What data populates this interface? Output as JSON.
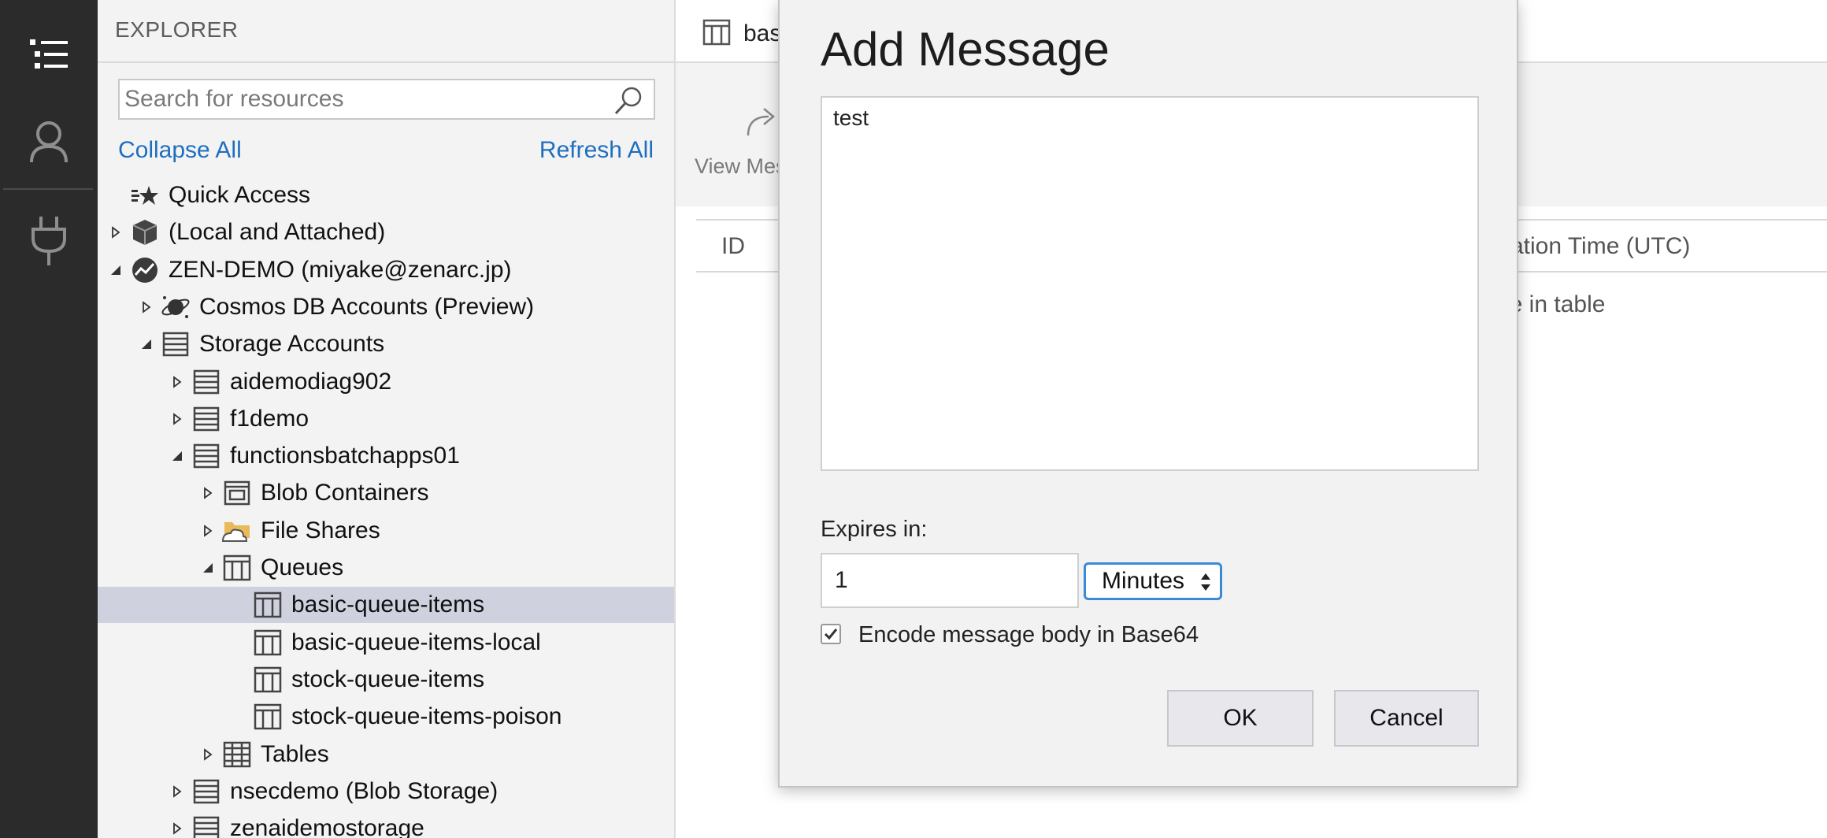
{
  "activity_bar": {
    "icons": [
      "explorer-list-icon",
      "account-icon",
      "plug-icon"
    ]
  },
  "explorer": {
    "title": "EXPLORER",
    "search_placeholder": "Search for resources",
    "collapse_all": "Collapse All",
    "refresh_all": "Refresh All",
    "tree": [
      {
        "label": "Quick Access",
        "level": 0,
        "icon": "quick-access-icon",
        "twisty": "none"
      },
      {
        "label": "(Local and Attached)",
        "level": 0,
        "icon": "cube-icon",
        "twisty": "collapsed"
      },
      {
        "label": "ZEN-DEMO (miyake@zenarc.jp)",
        "level": 0,
        "icon": "subscription-icon",
        "twisty": "expanded"
      },
      {
        "label": "Cosmos DB Accounts (Preview)",
        "level": 1,
        "icon": "cosmos-icon",
        "twisty": "collapsed"
      },
      {
        "label": "Storage Accounts",
        "level": 1,
        "icon": "storage-icon",
        "twisty": "expanded"
      },
      {
        "label": "aidemodiag902",
        "level": 2,
        "icon": "storage-icon",
        "twisty": "collapsed"
      },
      {
        "label": "f1demo",
        "level": 2,
        "icon": "storage-icon",
        "twisty": "collapsed"
      },
      {
        "label": "functionsbatchapps01",
        "level": 2,
        "icon": "storage-icon",
        "twisty": "expanded"
      },
      {
        "label": "Blob Containers",
        "level": 3,
        "icon": "blob-icon",
        "twisty": "collapsed"
      },
      {
        "label": "File Shares",
        "level": 3,
        "icon": "file-share-icon",
        "twisty": "collapsed"
      },
      {
        "label": "Queues",
        "level": 3,
        "icon": "queue-icon",
        "twisty": "expanded"
      },
      {
        "label": "basic-queue-items",
        "level": 4,
        "icon": "queue-icon",
        "twisty": "none",
        "selected": true
      },
      {
        "label": "basic-queue-items-local",
        "level": 4,
        "icon": "queue-icon",
        "twisty": "none"
      },
      {
        "label": "stock-queue-items",
        "level": 4,
        "icon": "queue-icon",
        "twisty": "none"
      },
      {
        "label": "stock-queue-items-poison",
        "level": 4,
        "icon": "queue-icon",
        "twisty": "none"
      },
      {
        "label": "Tables",
        "level": 3,
        "icon": "table-icon",
        "twisty": "collapsed"
      },
      {
        "label": "nsecdemo (Blob Storage)",
        "level": 2,
        "icon": "storage-icon",
        "twisty": "collapsed"
      },
      {
        "label": "zenaidemostorage",
        "level": 2,
        "icon": "storage-icon",
        "twisty": "collapsed"
      }
    ]
  },
  "main": {
    "tab_title": "bas",
    "toolbar_label": "View Mes",
    "columns": {
      "id": "ID",
      "expiration": "ration Time (UTC)"
    },
    "empty_message": "le in table"
  },
  "dialog": {
    "title": "Add Message",
    "message_text": "test",
    "expires_label": "Expires in:",
    "expires_value": "1",
    "unit_selected": "Minutes",
    "encode_checked": true,
    "encode_label": "Encode message body in Base64",
    "ok_label": "OK",
    "cancel_label": "Cancel"
  },
  "colors": {
    "activity_bar_bg": "#2b2b2b",
    "explorer_bg": "#f3f3f3",
    "selected_row_bg": "#cfd2de",
    "link": "#1f6fbf",
    "select_border": "#3b8ad8"
  }
}
